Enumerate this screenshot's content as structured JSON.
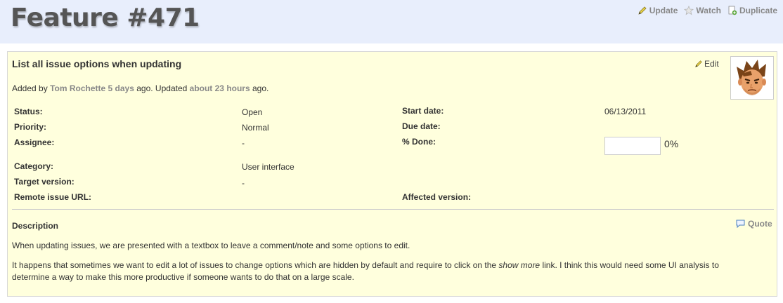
{
  "page": {
    "title": "Feature #471"
  },
  "contextual": {
    "update_label": "Update",
    "watch_label": "Watch",
    "duplicate_label": "Duplicate"
  },
  "issue": {
    "subject": "List all issue options when updating",
    "edit_label": "Edit",
    "author_line": {
      "prefix": "Added by",
      "author": "Tom Rochette",
      "created": "5 days",
      "middle": "ago. Updated",
      "updated": "about 23 hours",
      "suffix": "ago."
    },
    "attributes": {
      "status": {
        "label": "Status:",
        "value": "Open"
      },
      "priority": {
        "label": "Priority:",
        "value": "Normal"
      },
      "assignee": {
        "label": "Assignee:",
        "value": "-"
      },
      "category": {
        "label": "Category:",
        "value": "User interface"
      },
      "target_version": {
        "label": "Target version:",
        "value": "-"
      },
      "remote_url": {
        "label": "Remote issue URL:",
        "value": ""
      },
      "start_date": {
        "label": "Start date:",
        "value": "06/13/2011"
      },
      "due_date": {
        "label": "Due date:",
        "value": ""
      },
      "done": {
        "label": "% Done:",
        "value": "0%",
        "percent": 0
      },
      "affected_version": {
        "label": "Affected version:",
        "value": ""
      }
    },
    "description": {
      "title": "Description",
      "quote_label": "Quote",
      "p1": "When updating issues, we are presented with a textbox to leave a comment/note and some options to edit.",
      "p2_before": "It happens that sometimes we want to edit a lot of issues to change options which are hidden by default and require to click on the ",
      "p2_em": "show more",
      "p2_after": " link. I think this would need some UI analysis to determine a way to make this more productive if someone wants to do that on a large scale."
    }
  }
}
